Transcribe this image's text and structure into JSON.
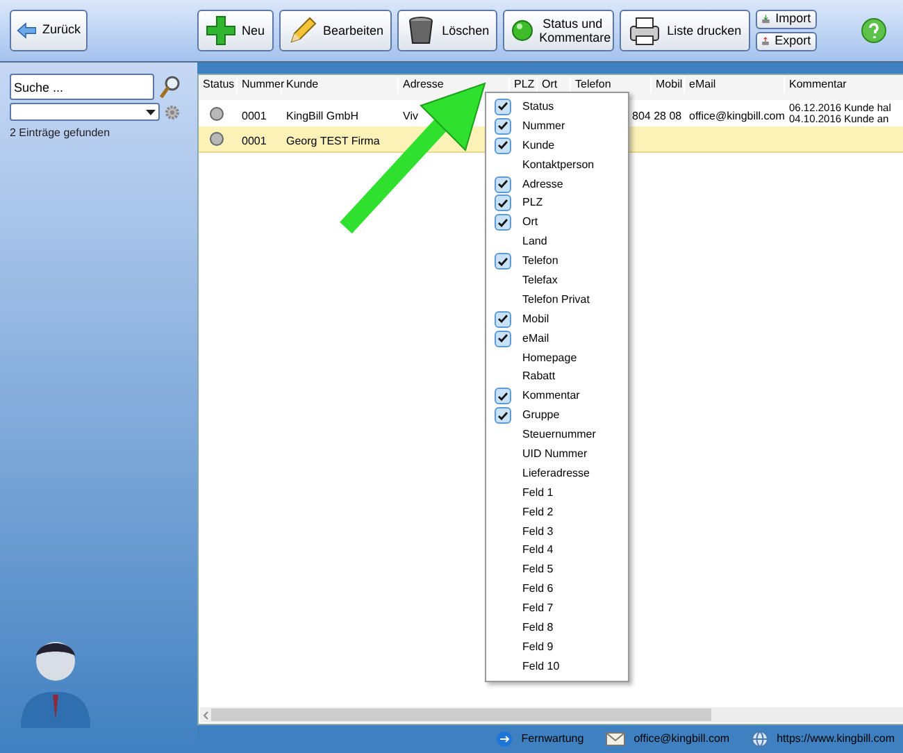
{
  "toolbar": {
    "back": "Zurück",
    "buttons": [
      {
        "kind": "new",
        "label": "Neu"
      },
      {
        "kind": "edit",
        "label": "Bearbeiten"
      },
      {
        "kind": "delete",
        "label": "Löschen"
      },
      {
        "kind": "status",
        "label": "Status und Kommentare"
      },
      {
        "kind": "print",
        "label": "Liste drucken"
      }
    ],
    "import": "Import",
    "export": "Export"
  },
  "sidebar": {
    "search": {
      "placeholder": "Suche ..."
    },
    "result": "2 Einträge gefunden"
  },
  "table": {
    "columns": [
      "Status",
      "Nummer",
      "Kunde",
      "Adresse",
      "PLZ",
      "Ort",
      "Telefon",
      "Mobil",
      "eMail",
      "Kommentar"
    ],
    "rows": [
      {
        "selected": false,
        "nummer": "0001",
        "kunde": "KingBill GmbH",
        "adresse": "Viv",
        "telefon": "804 28 08",
        "email": "office@kingbill.com",
        "kommentar": [
          "06.12.2016 Kunde hal",
          "04.10.2016 Kunde an"
        ]
      },
      {
        "selected": true,
        "nummer": "0001",
        "kunde": "Georg TEST Firma"
      }
    ]
  },
  "column_menu": [
    {
      "label": "Status",
      "checked": true
    },
    {
      "label": "Nummer",
      "checked": true
    },
    {
      "label": "Kunde",
      "checked": true
    },
    {
      "label": "Kontaktperson",
      "checked": false
    },
    {
      "label": "Adresse",
      "checked": true
    },
    {
      "label": "PLZ",
      "checked": true
    },
    {
      "label": "Ort",
      "checked": true
    },
    {
      "label": "Land",
      "checked": false
    },
    {
      "label": "Telefon",
      "checked": true
    },
    {
      "label": "Telefax",
      "checked": false
    },
    {
      "label": "Telefon Privat",
      "checked": false
    },
    {
      "label": "Mobil",
      "checked": true
    },
    {
      "label": "eMail",
      "checked": true
    },
    {
      "label": "Homepage",
      "checked": false
    },
    {
      "label": "Rabatt",
      "checked": false
    },
    {
      "label": "Kommentar",
      "checked": true
    },
    {
      "label": "Gruppe",
      "checked": true
    },
    {
      "label": "Steuernummer",
      "checked": false
    },
    {
      "label": "UID Nummer",
      "checked": false
    },
    {
      "label": "Lieferadresse",
      "checked": false
    },
    {
      "label": "Feld 1",
      "checked": false
    },
    {
      "label": "Feld 2",
      "checked": false
    },
    {
      "label": "Feld 3",
      "checked": false
    },
    {
      "label": "Feld 4",
      "checked": false
    },
    {
      "label": "Feld 5",
      "checked": false
    },
    {
      "label": "Feld 6",
      "checked": false
    },
    {
      "label": "Feld 7",
      "checked": false
    },
    {
      "label": "Feld 8",
      "checked": false
    },
    {
      "label": "Feld 9",
      "checked": false
    },
    {
      "label": "Feld 10",
      "checked": false
    }
  ],
  "status_bar": [
    {
      "kind": "remote",
      "label": "Fernwartung"
    },
    {
      "kind": "mail",
      "label": "office@kingbill.com"
    },
    {
      "kind": "web",
      "label": "https://www.kingbill.com"
    }
  ]
}
